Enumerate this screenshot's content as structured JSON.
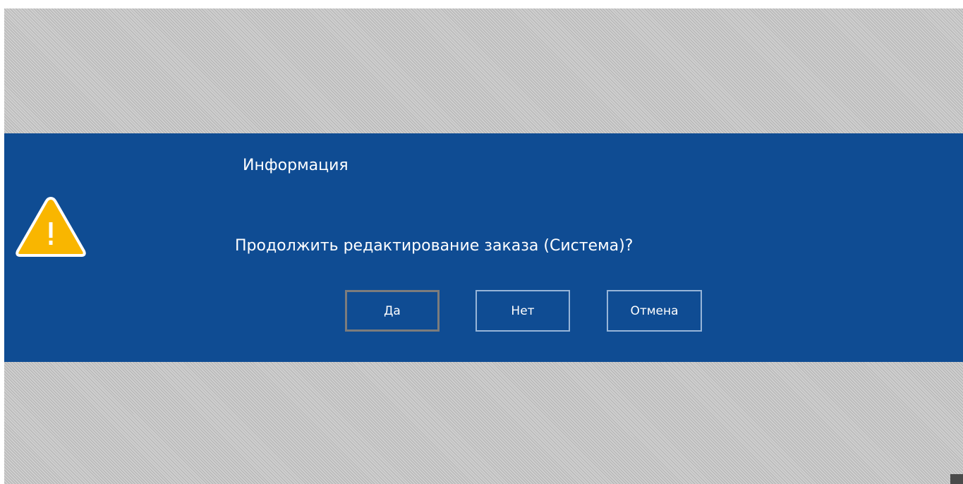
{
  "dialog": {
    "title": "Информация",
    "message": "Продолжить редактирование заказа (Система)?",
    "icon": "warning-icon",
    "background_color": "#0f4c93",
    "buttons": {
      "yes": "Да",
      "no": "Нет",
      "cancel": "Отмена"
    }
  },
  "colors": {
    "overlay": "#c4c4c4",
    "warning": "#f9b600",
    "button_border": "#97b5d8",
    "focused_button_border": "#7c7c7c"
  }
}
